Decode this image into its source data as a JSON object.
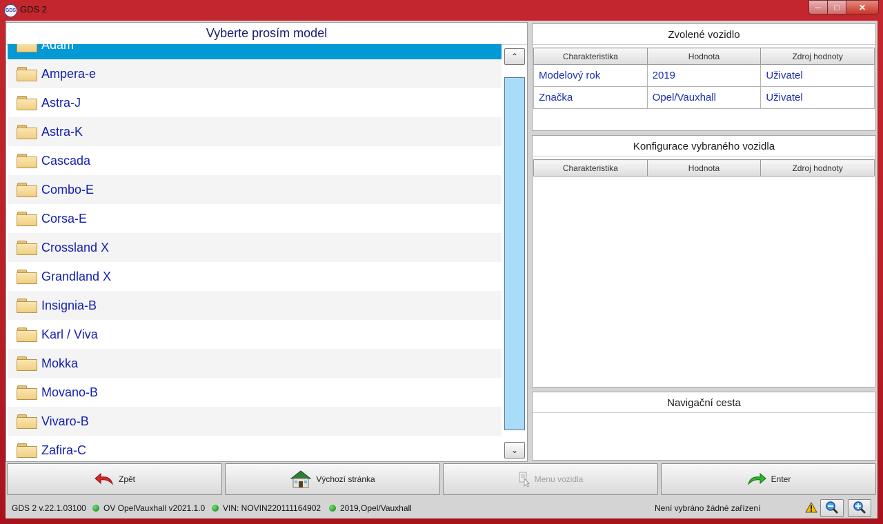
{
  "window": {
    "title": "GDS 2",
    "icon_label": "GDS"
  },
  "model_list": {
    "header": "Vyberte prosím model",
    "items": [
      "Adam",
      "Ampera-e",
      "Astra-J",
      "Astra-K",
      "Cascada",
      "Combo-E",
      "Corsa-E",
      "Crossland X",
      "Grandland X",
      "Insignia-B",
      "Karl / Viva",
      "Mokka",
      "Movano-B",
      "Vivaro-B",
      "Zafira-C"
    ],
    "selected": "Adam"
  },
  "selected_vehicle": {
    "title": "Zvolené vozidlo",
    "columns": [
      "Charakteristika",
      "Hodnota",
      "Zdroj hodnoty"
    ],
    "rows": [
      [
        "Modelový rok",
        "2019",
        "Uživatel"
      ],
      [
        "Značka",
        "Opel/Vauxhall",
        "Uživatel"
      ]
    ]
  },
  "configuration": {
    "title": "Konfigurace vybraného vozidla",
    "columns": [
      "Charakteristika",
      "Hodnota",
      "Zdroj hodnoty"
    ]
  },
  "navigation": {
    "title": "Navigační cesta"
  },
  "buttons": {
    "back": "Zpět",
    "home": "Výchozí stránka",
    "vehicle_menu": "Menu vozidla",
    "enter": "Enter"
  },
  "status": {
    "version": "GDS 2 v.22.1.03100",
    "database": "OV OpelVauxhall v2021.1.0",
    "vin": "VIN: NOVIN220111164902",
    "vehicle": "2019,Opel/Vauxhall",
    "device": "Není vybráno žádné zařízení"
  },
  "colors": {
    "selected_row": "#0399d4",
    "link_text": "#1420b0",
    "status_ok": "#1aa31a",
    "title_bar": "#c4262d"
  }
}
